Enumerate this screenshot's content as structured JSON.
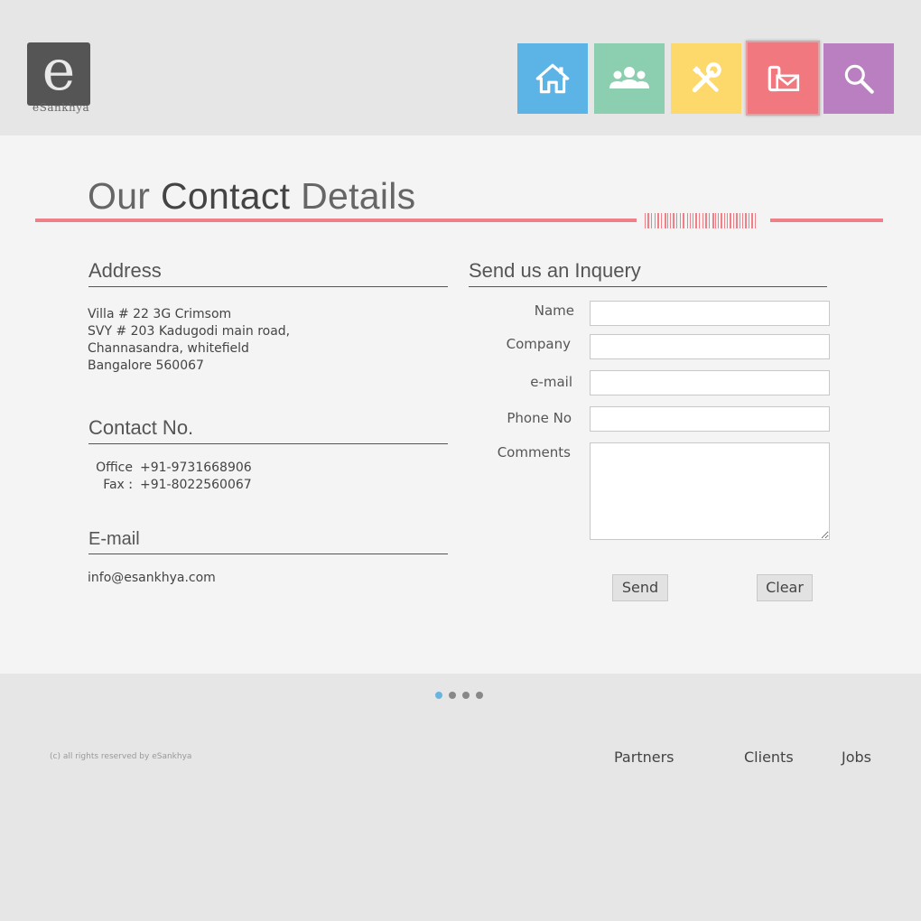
{
  "brand": {
    "logo_letter": "e",
    "logo_text": "eSankhya"
  },
  "nav": [
    {
      "name": "home",
      "icon": "home-icon",
      "color": "#5cb3e6"
    },
    {
      "name": "team",
      "icon": "people-icon",
      "color": "#8ccfb0"
    },
    {
      "name": "services",
      "icon": "tools-icon",
      "color": "#fcd96a"
    },
    {
      "name": "contact",
      "icon": "phone-mail-icon",
      "color": "#f2787f",
      "active": true
    },
    {
      "name": "search",
      "icon": "search-icon",
      "color": "#b97fc0"
    }
  ],
  "page": {
    "title_prefix": "Our",
    "title_bold": "Contact",
    "title_suffix": "Details",
    "accent_color": "#f08088"
  },
  "address": {
    "heading": "Address",
    "line1": "Villa # 22 3G  Crimsom",
    "line2": "SVY # 203 Kadugodi main road,",
    "line3": "Channasandra, whitefield",
    "line4": "Bangalore 560067"
  },
  "contact_no": {
    "heading": "Contact No.",
    "office_label": "Office :",
    "office_value": "+91-9731668906",
    "fax_label": "Fax :",
    "fax_value": "+91-8022560067"
  },
  "email": {
    "heading": "E-mail",
    "value": "info@esankhya.com"
  },
  "inquiry": {
    "heading": "Send us an Inquery",
    "name_label": "Name",
    "company_label": "Company",
    "email_label": "e-mail",
    "phone_label": "Phone No",
    "comments_label": "Comments",
    "name_value": "",
    "company_value": "",
    "email_value": "",
    "phone_value": "",
    "comments_value": "",
    "send_label": "Send",
    "clear_label": "Clear"
  },
  "pager": {
    "count": 4,
    "active_index": 0
  },
  "footer": {
    "copyright": "(c) all rights reserved by eSankhya",
    "links": [
      "Partners",
      "Clients",
      "Jobs"
    ]
  }
}
